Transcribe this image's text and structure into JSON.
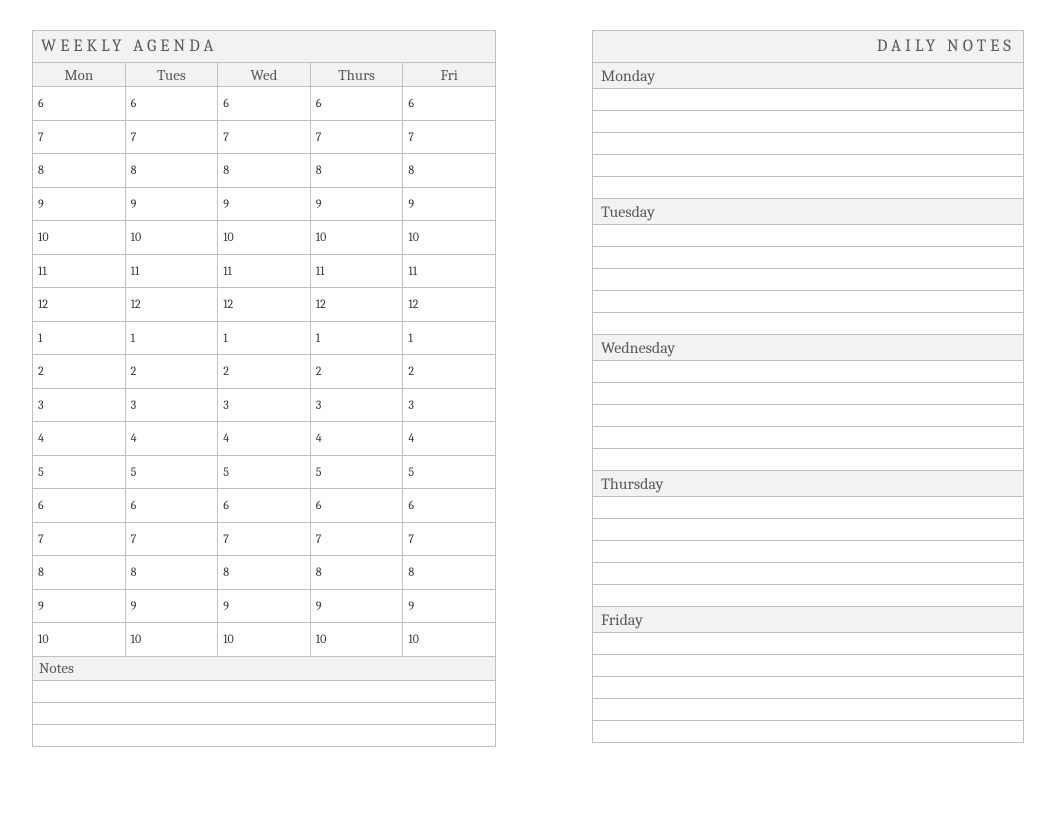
{
  "weekly": {
    "title": "WEEKLY AGENDA",
    "days": [
      "Mon",
      "Tues",
      "Wed",
      "Thurs",
      "Fri"
    ],
    "hours": [
      "6",
      "7",
      "8",
      "9",
      "10",
      "11",
      "12",
      "1",
      "2",
      "3",
      "4",
      "5",
      "6",
      "7",
      "8",
      "9",
      "10"
    ],
    "notes_label": "Notes",
    "notes_lines": 3
  },
  "daily": {
    "title": "DAILY NOTES",
    "sections": [
      "Monday",
      "Tuesday",
      "Wednesday",
      "Thursday",
      "Friday"
    ],
    "lines_per_section": 5
  }
}
